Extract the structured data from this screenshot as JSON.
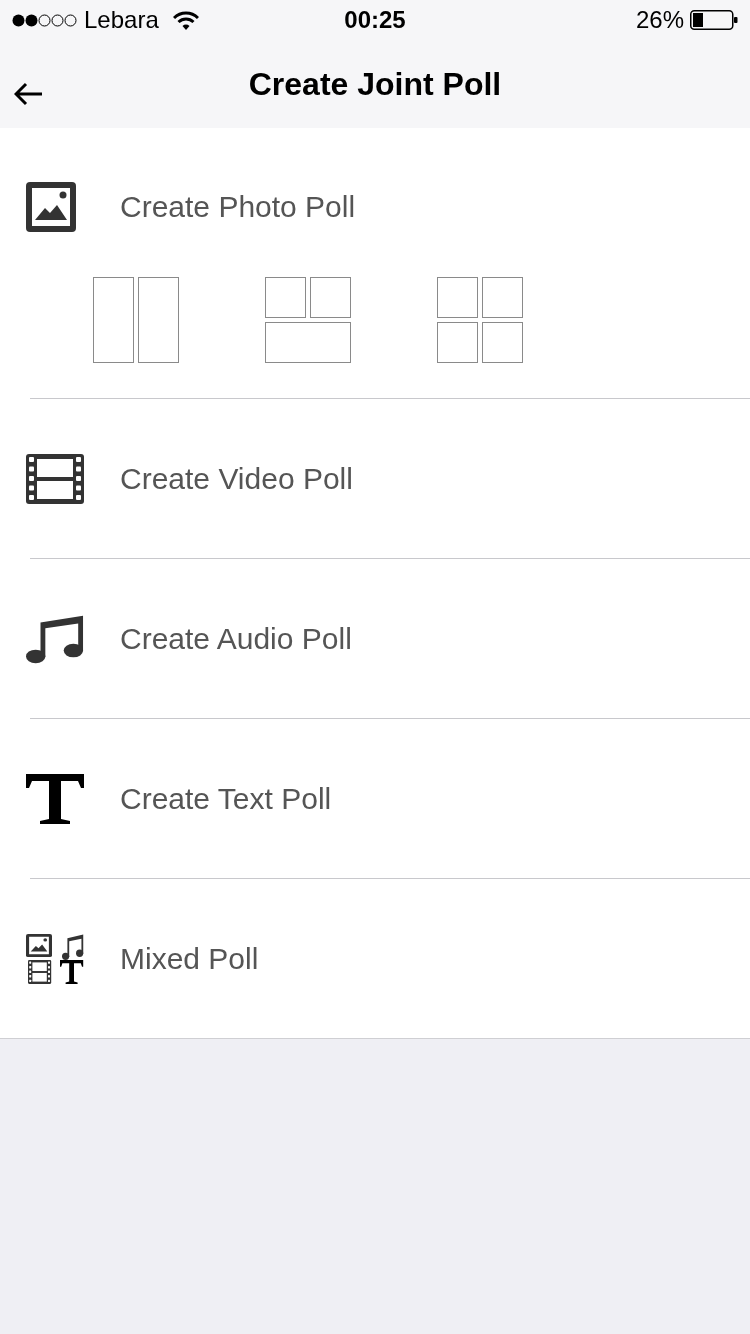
{
  "status_bar": {
    "carrier": "Lebara",
    "time": "00:25",
    "battery": "26%"
  },
  "nav_bar": {
    "title": "Create Joint Poll"
  },
  "poll_types": [
    {
      "kind": "photo",
      "label": "Create Photo Poll",
      "layouts": [
        {
          "kind": "two-columns"
        },
        {
          "kind": "two-over-one"
        },
        {
          "kind": "grid"
        }
      ]
    },
    {
      "kind": "video",
      "label": "Create Video Poll"
    },
    {
      "kind": "audio",
      "label": "Create Audio Poll"
    },
    {
      "kind": "text",
      "label": "Create Text Poll"
    },
    {
      "kind": "mixed",
      "label": "Mixed Poll"
    }
  ]
}
